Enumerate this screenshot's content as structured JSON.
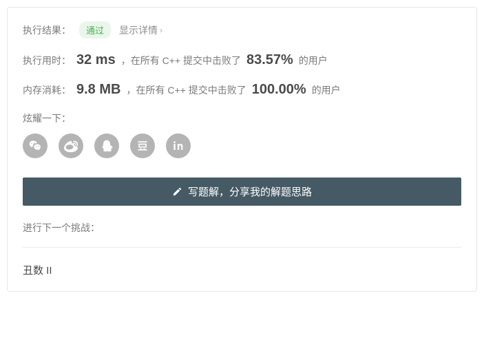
{
  "result": {
    "label": "执行结果：",
    "status": "通过",
    "details_link": "显示详情"
  },
  "runtime": {
    "label": "执行用时：",
    "value": "32 ms",
    "prefix": "，在所有 C++ 提交中击败了",
    "percent": "83.57%",
    "suffix": "的用户"
  },
  "memory": {
    "label": "内存消耗：",
    "value": "9.8 MB",
    "prefix": "，在所有 C++ 提交中击败了",
    "percent": "100.00%",
    "suffix": "的用户"
  },
  "share": {
    "label": "炫耀一下："
  },
  "solution_button": "写题解，分享我的解题思路",
  "next": {
    "label": "进行下一个挑战：",
    "title": "丑数 II"
  }
}
